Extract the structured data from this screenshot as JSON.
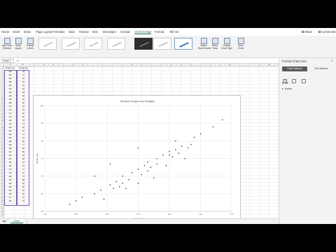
{
  "ribbon": {
    "tabs": [
      {
        "label": "Home"
      },
      {
        "label": "Insert"
      },
      {
        "label": "Draw"
      },
      {
        "label": "Page Layout"
      },
      {
        "label": "Formulas"
      },
      {
        "label": "Data"
      },
      {
        "label": "Review"
      },
      {
        "label": "View"
      },
      {
        "label": "Developer"
      },
      {
        "label": "Acrobat"
      },
      {
        "label": "Chart Design"
      },
      {
        "label": "Format"
      },
      {
        "label": "Tell me"
      }
    ],
    "active_tab_index": 10,
    "share_label": "Share",
    "comments_label": "Comments",
    "buttons_left": [
      {
        "label": "Add Chart Element"
      },
      {
        "label": "Quick Layout"
      },
      {
        "label": "Change Colors"
      }
    ],
    "buttons_right": [
      {
        "label": "Switch Row/Column"
      },
      {
        "label": "Select Data"
      },
      {
        "label": "Change Chart Type"
      },
      {
        "label": "Move Chart"
      }
    ]
  },
  "formula_bar": {
    "name_box": "Chart 1",
    "fx": "fx"
  },
  "grid": {
    "columns": [
      "A",
      "B",
      "C",
      "D",
      "E",
      "F",
      "G",
      "H",
      "I",
      "J",
      "K",
      "L",
      "M",
      "N",
      "O",
      "P",
      "Q",
      "R",
      "S",
      "T",
      "U",
      "V",
      "W",
      "X",
      "Y",
      "Z",
      "AA",
      "AB"
    ],
    "header_row": {
      "col1": "Height (cm)",
      "col2": "Weight (kg)"
    },
    "rows": [
      [
        "150",
        "45"
      ],
      [
        "152",
        "47"
      ],
      [
        "155",
        "50"
      ],
      [
        "158",
        "53"
      ],
      [
        "160",
        "52"
      ],
      [
        "162",
        "56"
      ],
      [
        "163",
        "59"
      ],
      [
        "165",
        "58"
      ],
      [
        "166",
        "62"
      ],
      [
        "168",
        "60"
      ],
      [
        "170",
        "65"
      ],
      [
        "171",
        "63"
      ],
      [
        "172",
        "68"
      ],
      [
        "174",
        "66"
      ],
      [
        "175",
        "70"
      ],
      [
        "176",
        "72"
      ],
      [
        "178",
        "69"
      ],
      [
        "180",
        "75"
      ],
      [
        "181",
        "73"
      ],
      [
        "183",
        "78"
      ],
      [
        "185",
        "80"
      ],
      [
        "186",
        "77"
      ],
      [
        "188",
        "82"
      ],
      [
        "190",
        "85"
      ],
      [
        "153",
        "55"
      ],
      [
        "157",
        "48"
      ],
      [
        "161",
        "61"
      ],
      [
        "167",
        "57"
      ],
      [
        "173",
        "71"
      ],
      [
        "179",
        "67"
      ],
      [
        "184",
        "74"
      ],
      [
        "189",
        "88"
      ],
      [
        "192",
        "90"
      ],
      [
        "196",
        "95"
      ],
      [
        "164",
        "64"
      ],
      [
        "169",
        "62"
      ],
      [
        "177",
        "76"
      ],
      [
        "182",
        "79"
      ]
    ]
  },
  "chart_data": {
    "type": "scatter",
    "title": "Student Height and Weights",
    "xlabel": "Height (cm)",
    "ylabel": "Weight (kg)",
    "xlim": [
      140,
      200
    ],
    "ylim": [
      40,
      100
    ],
    "x_ticks": [
      "140",
      "150",
      "160",
      "170",
      "180",
      "190",
      "200"
    ],
    "y_ticks": [
      "40",
      "50",
      "60",
      "70",
      "80",
      "90",
      "100"
    ],
    "grid": true,
    "series": [
      {
        "color": "#595959",
        "points": [
          [
            148,
            44
          ],
          [
            150,
            46
          ],
          [
            152,
            48
          ],
          [
            156,
            50
          ],
          [
            158,
            52
          ],
          [
            159,
            47
          ],
          [
            161,
            55
          ],
          [
            162,
            53
          ],
          [
            163,
            57
          ],
          [
            164,
            54
          ],
          [
            165,
            56
          ],
          [
            165,
            60
          ],
          [
            166,
            53
          ],
          [
            167,
            58
          ],
          [
            168,
            62
          ],
          [
            170,
            56
          ],
          [
            170,
            64
          ],
          [
            171,
            61
          ],
          [
            172,
            66
          ],
          [
            173,
            63
          ],
          [
            173,
            68
          ],
          [
            174,
            65
          ],
          [
            175,
            59
          ],
          [
            176,
            67
          ],
          [
            176,
            70
          ],
          [
            178,
            72
          ],
          [
            179,
            66
          ],
          [
            180,
            74
          ],
          [
            181,
            71
          ],
          [
            182,
            75
          ],
          [
            182,
            80
          ],
          [
            183,
            73
          ],
          [
            184,
            77
          ],
          [
            185,
            70
          ],
          [
            186,
            76
          ],
          [
            187,
            78
          ],
          [
            188,
            82
          ],
          [
            190,
            84
          ],
          [
            194,
            88
          ],
          [
            197,
            92
          ],
          [
            156,
            60
          ],
          [
            161,
            67
          ],
          [
            170,
            76
          ],
          [
            180,
            72
          ]
        ]
      }
    ]
  },
  "format_pane": {
    "title": "Format Chart Area",
    "tabs": [
      {
        "label": "Chart Options"
      },
      {
        "label": "Text Options"
      }
    ],
    "sections": [
      {
        "label": "Fill"
      },
      {
        "label": "Border"
      }
    ]
  },
  "sheet": {
    "tab_label": "Sheet1",
    "add_label": "+",
    "nav_label": "◀ ▶"
  },
  "colors": {
    "accent": "#1f6e43",
    "selection": "#7b5ea7",
    "marker": "#595959"
  }
}
